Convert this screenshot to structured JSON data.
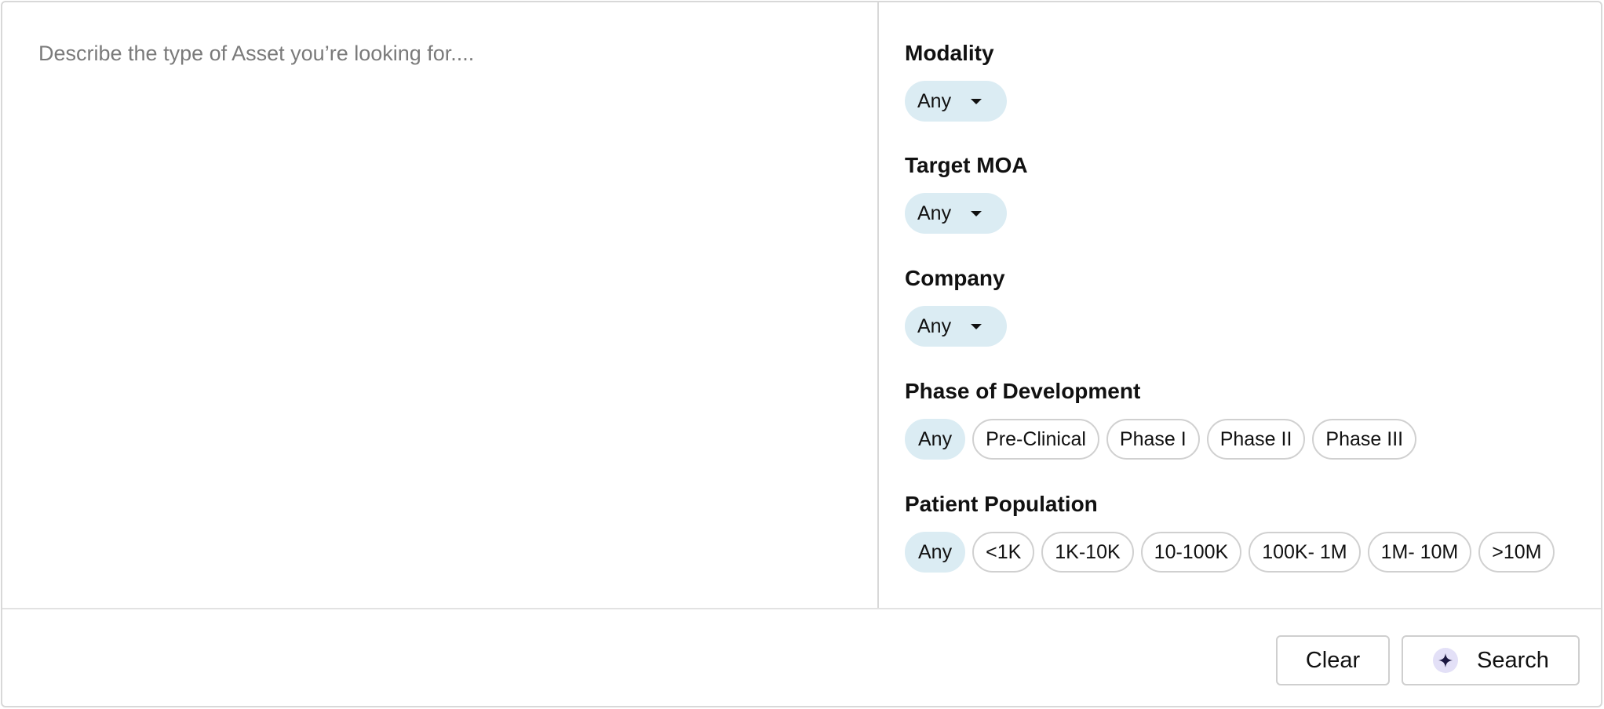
{
  "search": {
    "placeholder": "Describe the type of Asset you’re looking for....",
    "value": ""
  },
  "filters": {
    "modality": {
      "title": "Modality",
      "selected": "Any"
    },
    "target_moa": {
      "title": "Target MOA",
      "selected": "Any"
    },
    "company": {
      "title": "Company",
      "selected": "Any"
    },
    "phase": {
      "title": "Phase of Development",
      "options": [
        "Any",
        "Pre-Clinical",
        "Phase I",
        "Phase II",
        "Phase III"
      ],
      "selected": "Any"
    },
    "population": {
      "title": "Patient Population",
      "options": [
        "Any",
        "<1K",
        "1K-10K",
        "10-100K",
        "100K- 1M",
        "1M- 10M",
        ">10M"
      ],
      "selected": "Any"
    }
  },
  "footer": {
    "clear_label": "Clear",
    "search_label": "Search"
  },
  "icons": {
    "dropdown": "caret-down-icon",
    "search": "sparkle-icon"
  },
  "colors": {
    "chip_active_bg": "#dbecf3",
    "sparkle_bg": "#e3e0f7",
    "sparkle_fg": "#1b1740"
  }
}
